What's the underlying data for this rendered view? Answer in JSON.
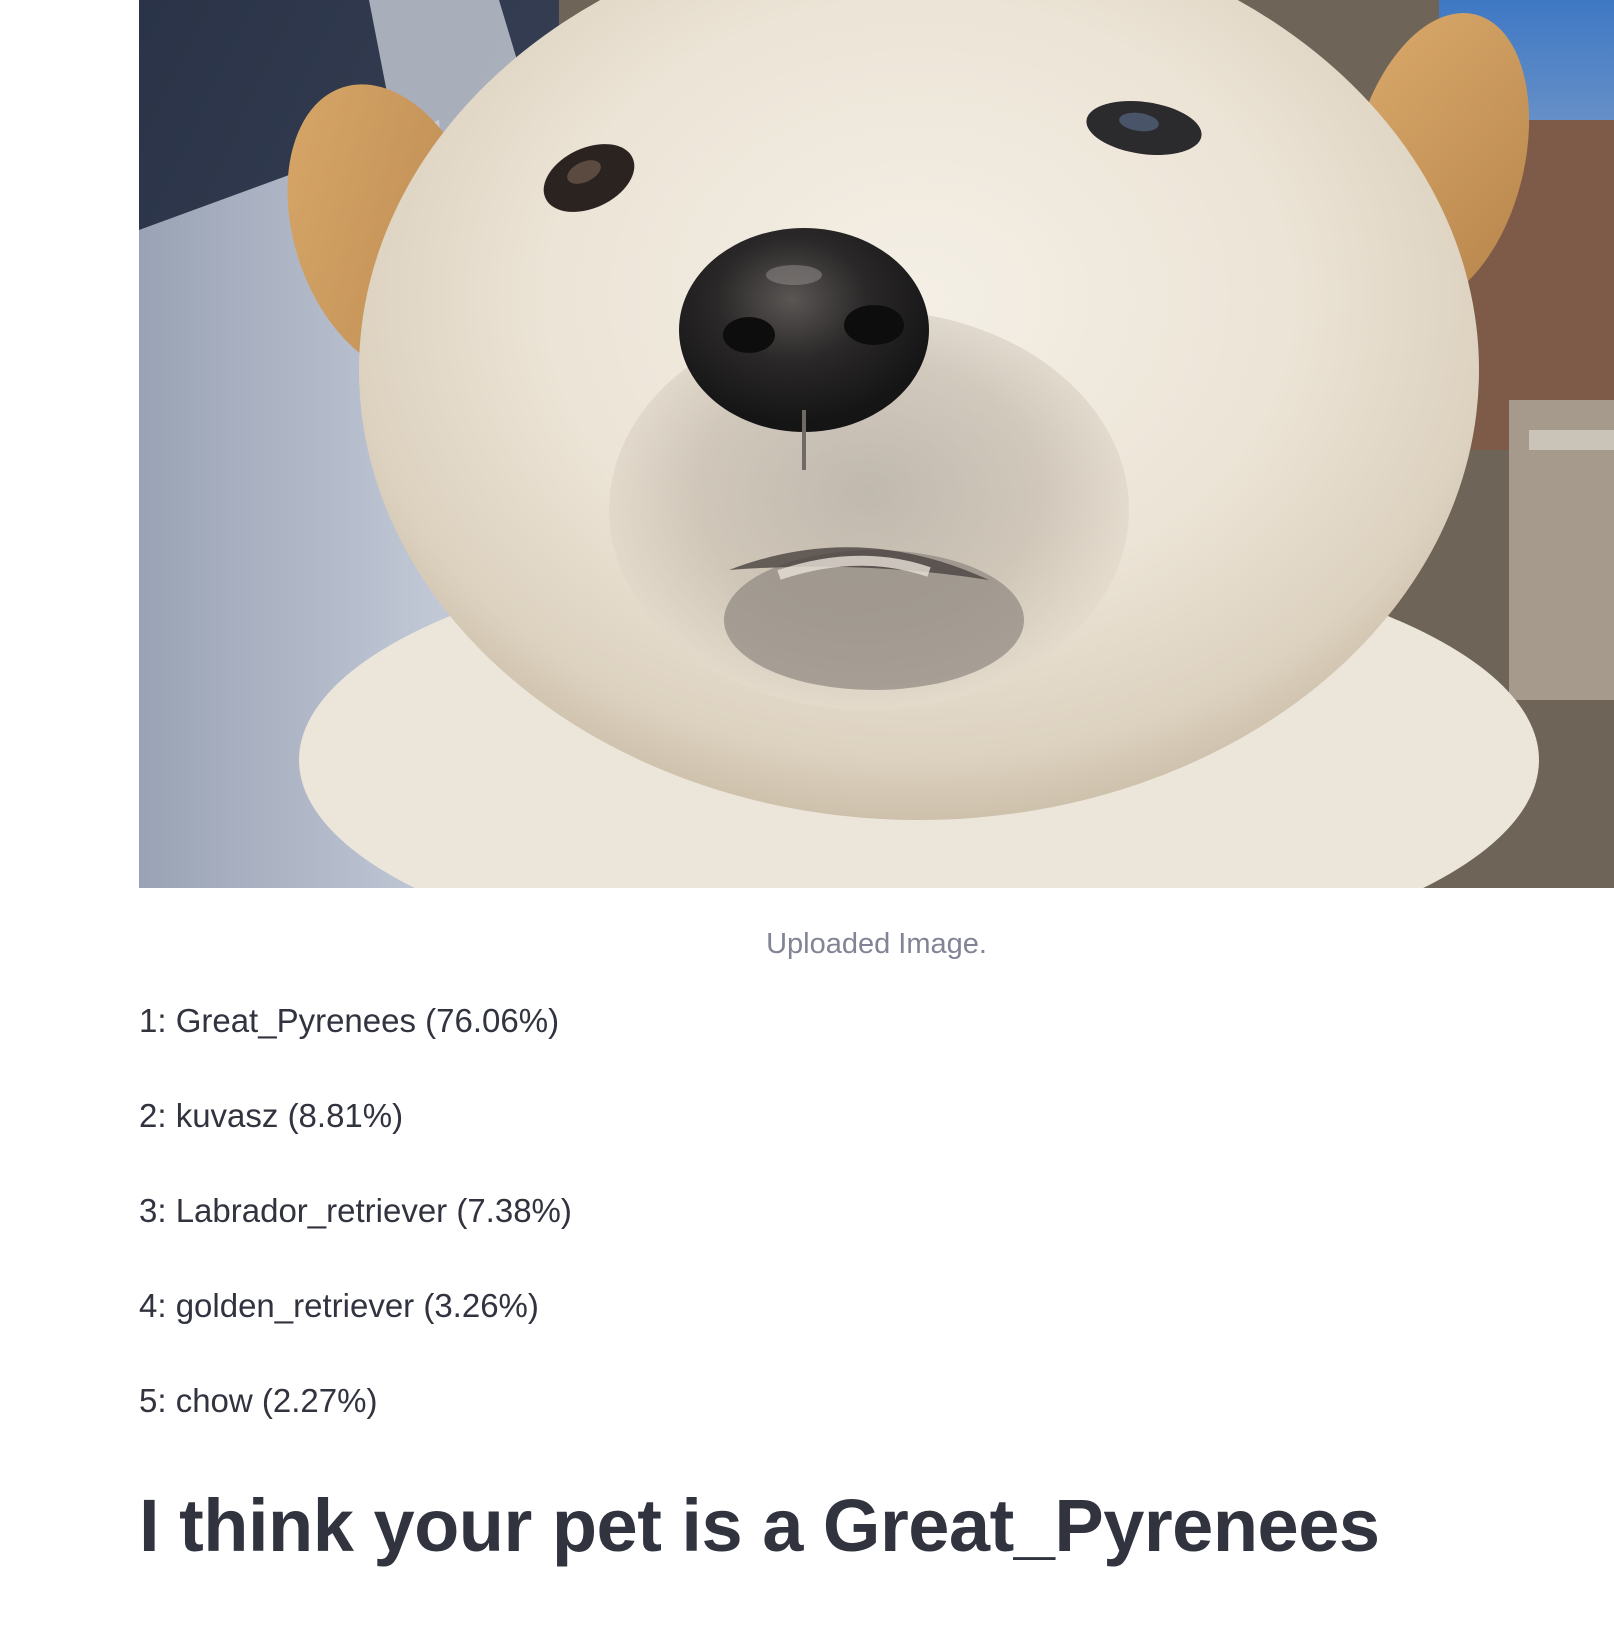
{
  "image": {
    "caption": "Uploaded Image."
  },
  "predictions": [
    "1: Great_Pyrenees (76.06%)",
    "2: kuvasz (8.81%)",
    "3: Labrador_retriever (7.38%)",
    "4: golden_retriever (3.26%)",
    "5: chow (2.27%)"
  ],
  "verdict": "I think your pet is a Great_Pyrenees"
}
